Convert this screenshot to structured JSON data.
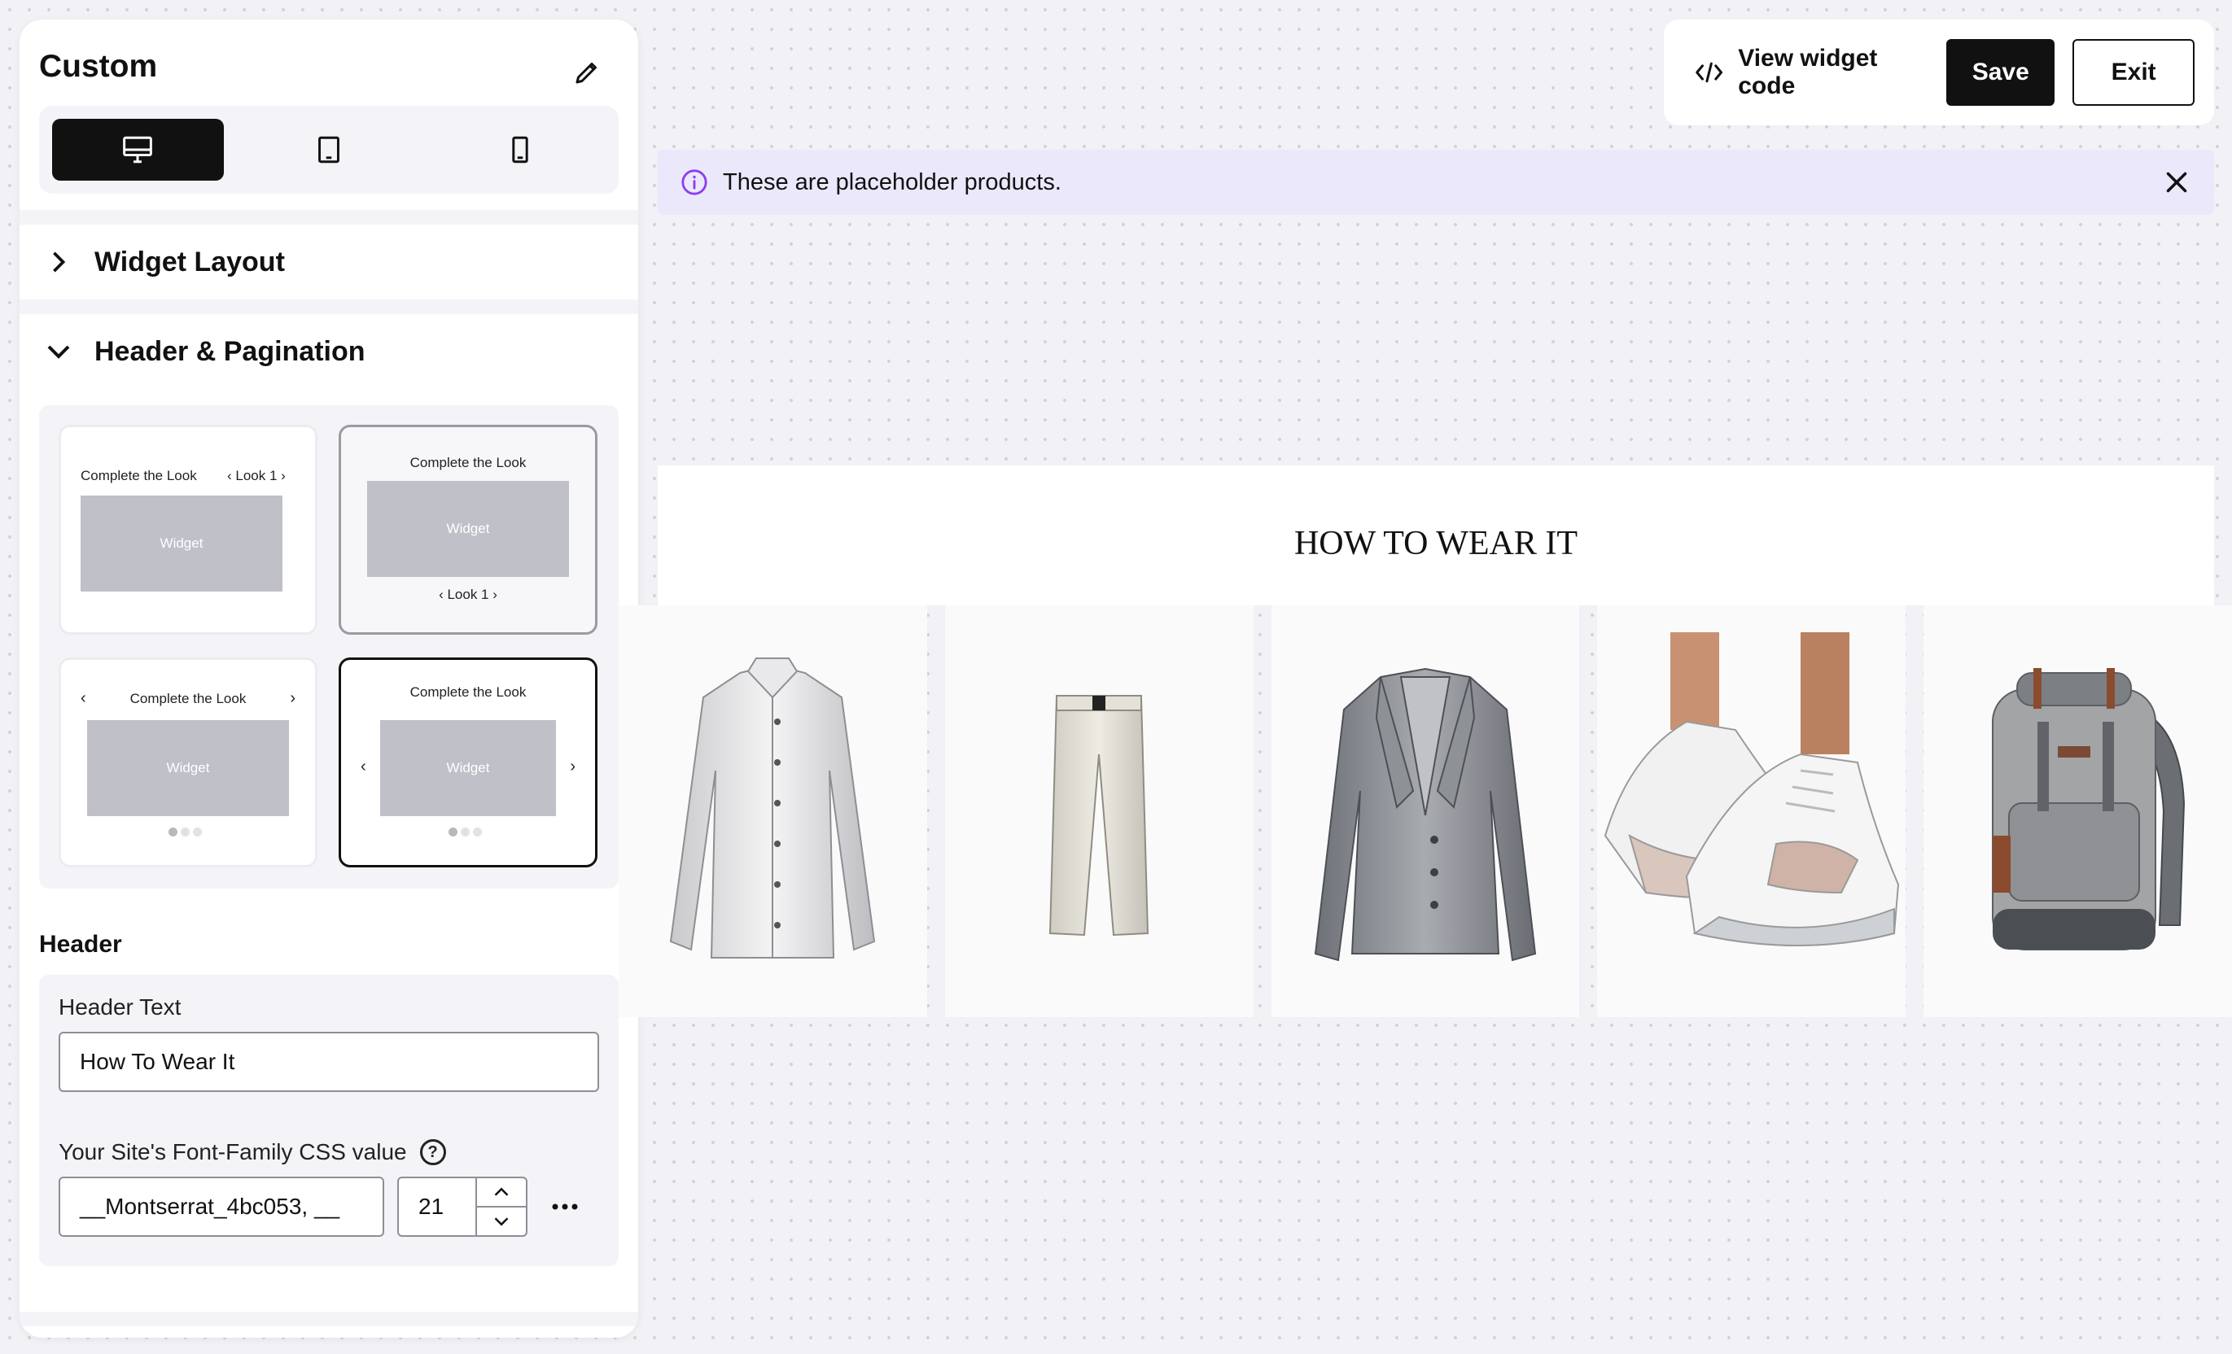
{
  "sidebar": {
    "title": "Custom",
    "devices": [
      "desktop",
      "tablet",
      "mobile"
    ],
    "sections": {
      "widget_layout": "Widget Layout",
      "header_pagination": "Header & Pagination"
    },
    "layout_options": {
      "title": "Complete the Look",
      "pagination": "Look 1",
      "widget": "Widget"
    },
    "header_heading": "Header",
    "header_text_label": "Header Text",
    "header_text_value": "How To Wear It",
    "font_family_label": "Your Site's Font-Family CSS value",
    "font_family_value": "__Montserrat_4bc053, __",
    "font_size_value": "21",
    "help_glyph": "?"
  },
  "toolbar": {
    "view_code_label": "View widget code",
    "save_label": "Save",
    "exit_label": "Exit"
  },
  "banner": {
    "message": "These are placeholder products."
  },
  "preview": {
    "header_title": "HOW TO WEAR IT",
    "products": [
      "shirt",
      "trousers",
      "jacket",
      "sneakers",
      "backpack"
    ]
  },
  "colors": {
    "accent_purple": "#8a3ff0",
    "banner_bg": "#ece8fb",
    "primary_black": "#111111"
  }
}
